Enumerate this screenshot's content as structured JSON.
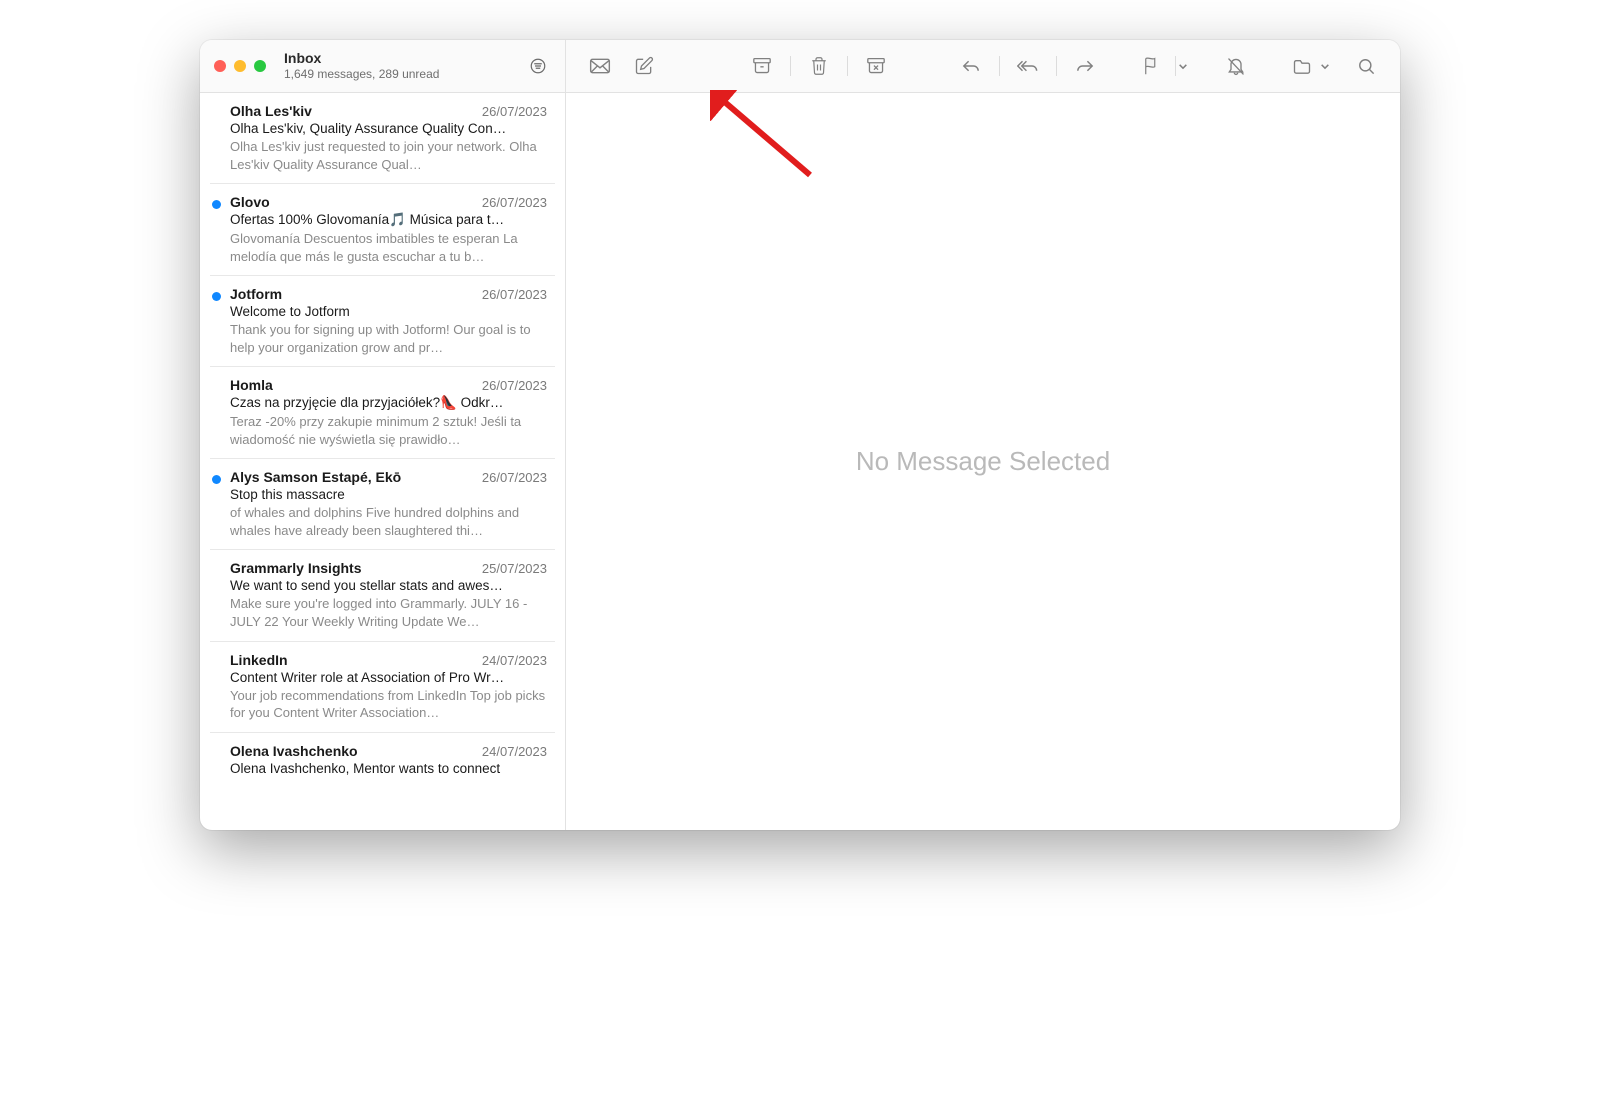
{
  "header": {
    "mailbox": "Inbox",
    "subtitle": "1,649 messages, 289 unread"
  },
  "main": {
    "empty_state": "No Message Selected"
  },
  "colors": {
    "accent": "#1088ff",
    "traffic_close": "#ff5f57",
    "traffic_min": "#febc2e",
    "traffic_max": "#28c840",
    "arrow": "#e11d1d"
  },
  "toolbar": {
    "icons": [
      "get-mail-icon",
      "compose-icon",
      "archive-icon",
      "delete-icon",
      "junk-icon",
      "reply-icon",
      "reply-all-icon",
      "forward-icon",
      "flag-icon",
      "mute-icon",
      "move-icon",
      "search-icon"
    ]
  },
  "messages": [
    {
      "sender": "Olha Les'kiv",
      "date": "26/07/2023",
      "subject": "Olha Les'kiv, Quality Assurance Quality Con…",
      "preview": "Olha Les'kiv just requested to join your network. Olha Les'kiv Quality Assurance Qual…",
      "unread": false
    },
    {
      "sender": "Glovo",
      "date": "26/07/2023",
      "subject": "Ofertas 100% Glovomanía🎵 Música para t…",
      "preview": "Glovomanía Descuentos imbatibles te esperan La melodía que más le gusta escuchar a tu b…",
      "unread": true
    },
    {
      "sender": "Jotform",
      "date": "26/07/2023",
      "subject": "Welcome to Jotform",
      "preview": "Thank you for signing up with Jotform! Our goal is to help your organization grow and pr…",
      "unread": true
    },
    {
      "sender": "Homla",
      "date": "26/07/2023",
      "subject": "Czas na przyjęcie dla przyjaciółek?👠 Odkr…",
      "preview": "Teraz -20% przy zakupie minimum 2 sztuk! Jeśli ta wiadomość nie wyświetla się prawidło…",
      "unread": false
    },
    {
      "sender": "Alys Samson Estapé, Ekō",
      "date": "26/07/2023",
      "subject": "Stop this massacre",
      "preview": "of whales and dolphins Five hundred dolphins and whales have already been slaughtered thi…",
      "unread": true
    },
    {
      "sender": "Grammarly Insights",
      "date": "25/07/2023",
      "subject": "We want to send you stellar stats and awes…",
      "preview": "Make sure you're logged into Grammarly. JULY 16 - JULY 22 Your Weekly Writing Update We…",
      "unread": false
    },
    {
      "sender": "LinkedIn",
      "date": "24/07/2023",
      "subject": "Content Writer role at Association of Pro Wr…",
      "preview": "Your job recommendations from LinkedIn Top job picks for you Content Writer Association…",
      "unread": false
    },
    {
      "sender": "Olena Ivashchenko",
      "date": "24/07/2023",
      "subject": "Olena Ivashchenko, Mentor wants to connect",
      "preview": "",
      "unread": false
    }
  ]
}
